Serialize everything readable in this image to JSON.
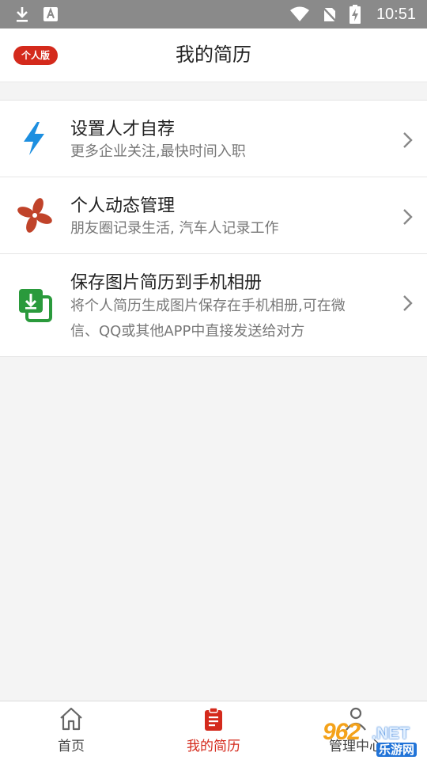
{
  "status_bar": {
    "time": "10:51"
  },
  "header": {
    "badge": "个人版",
    "title": "我的简历"
  },
  "menu": {
    "items": [
      {
        "title": "设置人才自荐",
        "description": "更多企业关注,最快时间入职",
        "icon": "lightning-icon"
      },
      {
        "title": "个人动态管理",
        "description": "朋友圈记录生活, 汽车人记录工作",
        "icon": "pinwheel-icon"
      },
      {
        "title": "保存图片简历到手机相册",
        "description_line1": "将个人简历生成图片保存在手机相册,可在微",
        "description_line2": "信、QQ或其他APP中直接发送给对方",
        "icon": "save-image-icon"
      }
    ]
  },
  "tab_bar": {
    "tabs": [
      {
        "label": "首页",
        "icon": "home-icon"
      },
      {
        "label": "我的简历",
        "icon": "clipboard-icon",
        "active": true
      },
      {
        "label": "管理中心",
        "icon": "user-icon"
      }
    ]
  },
  "watermark": {
    "number": "962",
    "suffix": ".NET",
    "site": "乐游网"
  },
  "colors": {
    "accent": "#d42a1c",
    "lightning": "#1d8fe0",
    "pinwheel": "#c0432a",
    "save": "#2a9a3c"
  }
}
